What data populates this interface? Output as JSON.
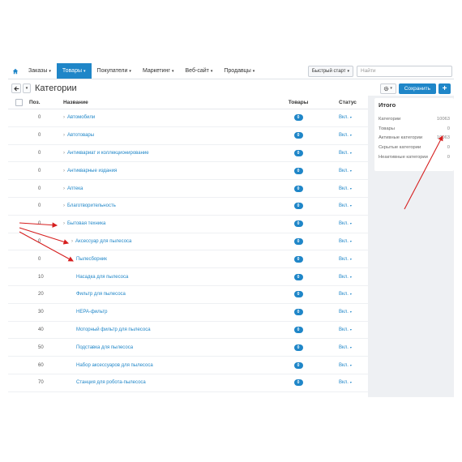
{
  "navbar": {
    "items": [
      {
        "label": "Заказы",
        "caret": "▾",
        "active": false
      },
      {
        "label": "Товары",
        "caret": "▾",
        "active": true
      },
      {
        "label": "Покупатели",
        "caret": "▾",
        "active": false
      },
      {
        "label": "Маркетинг",
        "caret": "▾",
        "active": false
      },
      {
        "label": "Веб-сайт",
        "caret": "▾",
        "active": false
      },
      {
        "label": "Продавцы",
        "caret": "▾",
        "active": false
      }
    ],
    "quick_start_label": "Быстрый старт",
    "quick_start_caret": "▾",
    "search_placeholder": "Найти"
  },
  "header": {
    "title": "Категории",
    "back_icon": "arrow-left-icon",
    "menu_caret": "▾",
    "gear_caret": "▾",
    "save_label": "Сохранить",
    "add_label": "+"
  },
  "table": {
    "columns": {
      "pos": "Поз.",
      "name": "Название",
      "goods": "Товары",
      "status": "Статус"
    },
    "rows": [
      {
        "pos": "0",
        "toggle": "›",
        "name": "Автомобили",
        "indent": 0,
        "goods": "0",
        "status": "Вкл."
      },
      {
        "pos": "0",
        "toggle": "›",
        "name": "Автотовары",
        "indent": 0,
        "goods": "0",
        "status": "Вкл."
      },
      {
        "pos": "0",
        "toggle": "›",
        "name": "Антиквариат и коллекционирование",
        "indent": 0,
        "goods": "0",
        "status": "Вкл."
      },
      {
        "pos": "0",
        "toggle": "›",
        "name": "Антикварные издания",
        "indent": 0,
        "goods": "0",
        "status": "Вкл."
      },
      {
        "pos": "0",
        "toggle": "›",
        "name": "Аптека",
        "indent": 0,
        "goods": "0",
        "status": "Вкл."
      },
      {
        "pos": "0",
        "toggle": "›",
        "name": "Благотворительность",
        "indent": 0,
        "goods": "0",
        "status": "Вкл."
      },
      {
        "pos": "0",
        "toggle": "›",
        "name": "Бытовая техника",
        "indent": 0,
        "goods": "0",
        "status": "Вкл."
      },
      {
        "pos": "0",
        "toggle": "›",
        "name": "Аксессуар для пылесоса",
        "indent": 1,
        "goods": "0",
        "status": "Вкл."
      },
      {
        "pos": "0",
        "toggle": "",
        "name": "Пылесборник",
        "indent": 2,
        "goods": "0",
        "status": "Вкл."
      },
      {
        "pos": "10",
        "toggle": "",
        "name": "Насадка для пылесоса",
        "indent": 2,
        "goods": "0",
        "status": "Вкл."
      },
      {
        "pos": "20",
        "toggle": "",
        "name": "Фильтр для пылесоса",
        "indent": 2,
        "goods": "0",
        "status": "Вкл."
      },
      {
        "pos": "30",
        "toggle": "",
        "name": "HEPA-фильтр",
        "indent": 2,
        "goods": "0",
        "status": "Вкл."
      },
      {
        "pos": "40",
        "toggle": "",
        "name": "Моторный фильтр для пылесоса",
        "indent": 2,
        "goods": "0",
        "status": "Вкл."
      },
      {
        "pos": "50",
        "toggle": "",
        "name": "Подставка для пылесоса",
        "indent": 2,
        "goods": "0",
        "status": "Вкл."
      },
      {
        "pos": "60",
        "toggle": "",
        "name": "Набор аксессуаров для пылесоса",
        "indent": 2,
        "goods": "0",
        "status": "Вкл."
      },
      {
        "pos": "70",
        "toggle": "",
        "name": "Станция для робота-пылесоса",
        "indent": 2,
        "goods": "0",
        "status": "Вкл."
      }
    ],
    "status_caret": "▾"
  },
  "summary": {
    "title": "Итого",
    "rows": [
      {
        "label": "Категории",
        "value": "10063"
      },
      {
        "label": "Товары",
        "value": "0"
      },
      {
        "label": "Активные категории",
        "value": "10063"
      },
      {
        "label": "Скрытые категории",
        "value": "0"
      },
      {
        "label": "Неактивные категории",
        "value": "0"
      }
    ]
  },
  "colors": {
    "accent": "#1f86c8",
    "annotation_arrow": "#d61f1f"
  }
}
